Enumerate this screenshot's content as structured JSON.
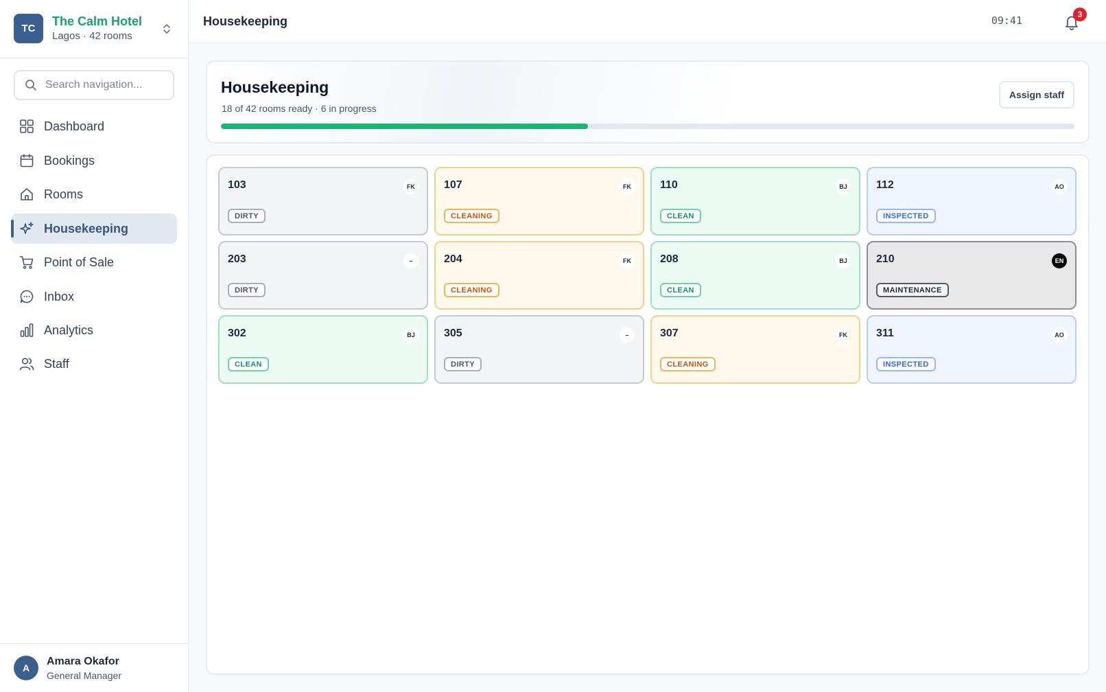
{
  "hotel": {
    "initials": "TC",
    "name": "The Calm Hotel",
    "subtitle": "Lagos · 42 rooms"
  },
  "search": {
    "placeholder": "Search navigation..."
  },
  "nav": [
    {
      "id": "dashboard",
      "label": "Dashboard",
      "icon": "grid-icon"
    },
    {
      "id": "bookings",
      "label": "Bookings",
      "icon": "calendar-icon"
    },
    {
      "id": "rooms",
      "label": "Rooms",
      "icon": "home-icon"
    },
    {
      "id": "housekeeping",
      "label": "Housekeeping",
      "icon": "sparkles-icon",
      "active": true
    },
    {
      "id": "point-of-sale",
      "label": "Point of Sale",
      "icon": "cart-icon"
    },
    {
      "id": "inbox",
      "label": "Inbox",
      "icon": "chat-icon"
    },
    {
      "id": "analytics",
      "label": "Analytics",
      "icon": "bar-chart-icon"
    },
    {
      "id": "staff",
      "label": "Staff",
      "icon": "users-icon"
    }
  ],
  "user": {
    "initial": "A",
    "name": "Amara Okafor",
    "role": "General Manager"
  },
  "topbar": {
    "title": "Housekeeping",
    "time": "09:41",
    "notifications": "3"
  },
  "summary": {
    "title": "Housekeeping",
    "subtitle": "18 of 42 rooms ready · 6 in progress",
    "assign_label": "Assign staff",
    "progress": 0.43
  },
  "rooms": [
    {
      "number": "103",
      "staff": "FK",
      "status": "DIRTY"
    },
    {
      "number": "107",
      "staff": "FK",
      "status": "CLEANING"
    },
    {
      "number": "110",
      "staff": "BJ",
      "status": "CLEAN"
    },
    {
      "number": "112",
      "staff": "AO",
      "status": "INSPECTED"
    },
    {
      "number": "203",
      "staff": "–",
      "status": "DIRTY"
    },
    {
      "number": "204",
      "staff": "FK",
      "status": "CLEANING"
    },
    {
      "number": "208",
      "staff": "BJ",
      "status": "CLEAN"
    },
    {
      "number": "210",
      "staff": "EN",
      "status": "MAINTENANCE"
    },
    {
      "number": "302",
      "staff": "BJ",
      "status": "CLEAN"
    },
    {
      "number": "305",
      "staff": "–",
      "status": "DIRTY"
    },
    {
      "number": "307",
      "staff": "FK",
      "status": "CLEANING"
    },
    {
      "number": "311",
      "staff": "AO",
      "status": "INSPECTED"
    }
  ],
  "colors": {
    "brand": "#3b5f8f",
    "hotel_name": "#16a366",
    "progress": "#16b673",
    "badge": "#e11d2e"
  }
}
